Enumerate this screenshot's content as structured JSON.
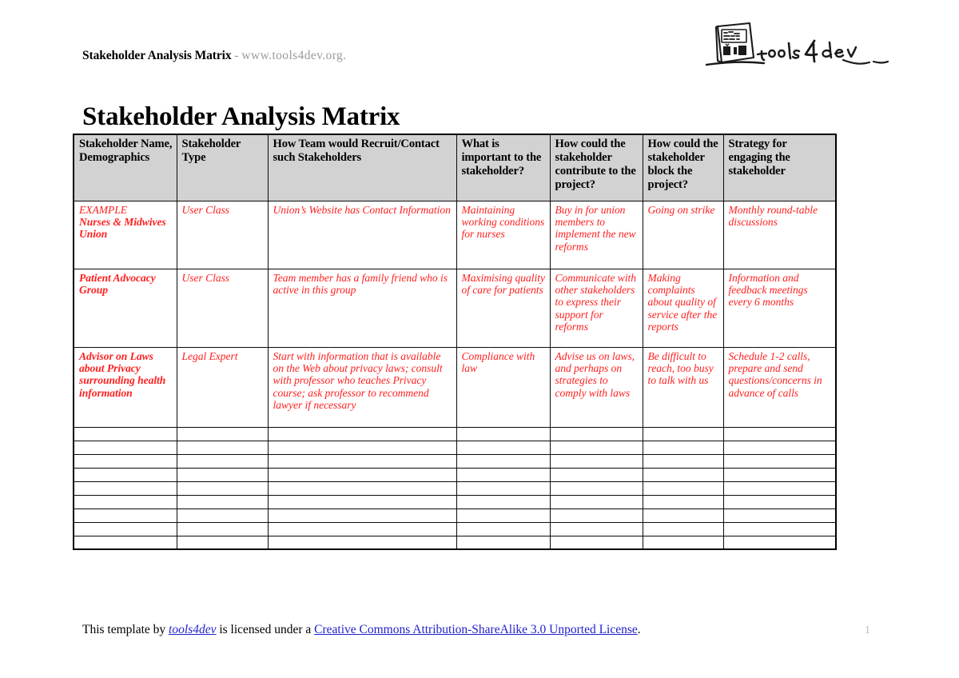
{
  "header": {
    "caption_title": "Stakeholder Analysis Matrix",
    "caption_separator": " - ",
    "caption_url": "www.tools4dev.org.",
    "logo_alt": "tools4dev",
    "logo_wordmark": "tools4dev"
  },
  "title": "Stakeholder Analysis Matrix",
  "table": {
    "columns": [
      "Stakeholder Name, Demographics",
      "Stakeholder Type",
      "How Team would Recruit/Contact such Stakeholders",
      "What is important to the stakeholder?",
      "How could the stakeholder contribute to the project?",
      "How could the stakeholder block the project?",
      "Strategy for engaging the stakeholder"
    ],
    "rows": [
      {
        "name_plain": "EXAMPLE",
        "name_strong": "Nurses & Midwives Union",
        "type": "User Class",
        "recruit": "Union’s Website has Contact Information",
        "important": "Maintaining working conditions for nurses",
        "contribute": "Buy in for union members to implement the new reforms",
        "block": "Going on strike",
        "strategy": "Monthly round-table discussions"
      },
      {
        "name_plain": "",
        "name_strong": "Patient Advocacy Group",
        "type": "User Class",
        "recruit": "Team member has a family friend who is active in this group",
        "important": "Maximising quality of care for patients",
        "contribute": "Communicate with other stakeholders to express their support for reforms",
        "block": "Making complaints about quality of service after the reports",
        "strategy": "Information and feedback meetings every 6 months"
      },
      {
        "name_plain": "",
        "name_strong": "Advisor on Laws about Privacy surrounding health information",
        "type": "Legal Expert",
        "recruit": "Start with information that is available on the Web about privacy laws; consult with professor who teaches Privacy course; ask professor to recommend lawyer if necessary",
        "important": "Compliance with law",
        "contribute": "Advise us on laws, and perhaps on strategies to comply with laws",
        "block": "Be difficult to reach, too busy to talk with us",
        "strategy": "Schedule 1-2 calls, prepare and send questions/concerns in advance of calls"
      }
    ],
    "empty_row_count": 9
  },
  "footer": {
    "text_before_link1": "This template by ",
    "link1": "tools4dev",
    "text_between": " is licensed under a ",
    "link2": "Creative Commons Attribution-ShareAlike 3.0 Unported License",
    "text_after": ".",
    "page_number": "1"
  },
  "colors": {
    "sample_text_red": "#ff1f1f",
    "header_fill": "#d2d2d2",
    "link_blue": "#2222cc",
    "muted_gray": "#9a9a9a",
    "page_number_gray": "#b9b9b9"
  }
}
